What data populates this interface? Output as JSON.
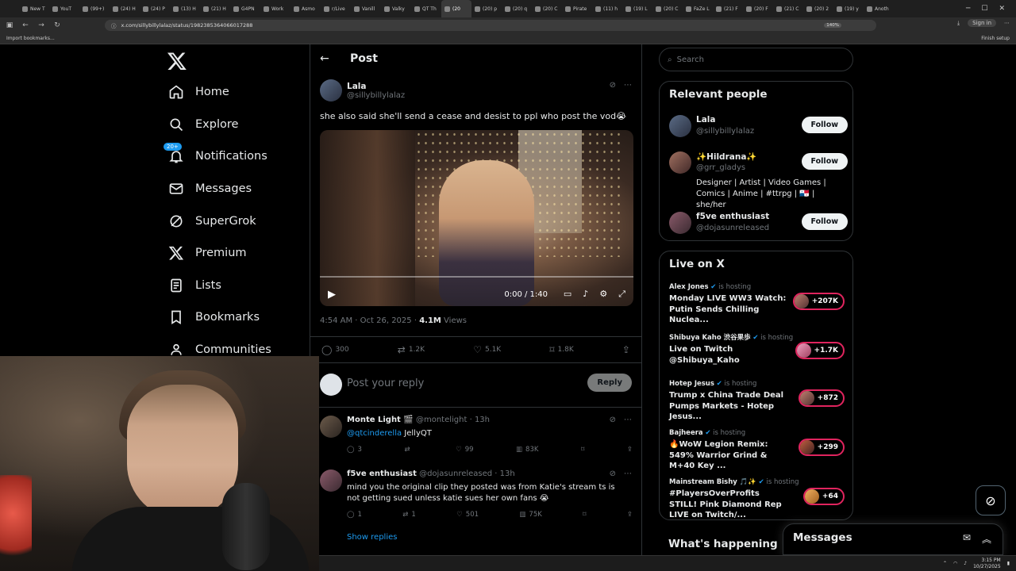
{
  "browser": {
    "tabs": [
      {
        "label": "New T"
      },
      {
        "label": "YouT"
      },
      {
        "label": "(99+)"
      },
      {
        "label": "(24) H"
      },
      {
        "label": "(24) P"
      },
      {
        "label": "(13) H"
      },
      {
        "label": "(21) H"
      },
      {
        "label": "G4PN"
      },
      {
        "label": "Work"
      },
      {
        "label": "Asmo"
      },
      {
        "label": "r/Live"
      },
      {
        "label": "Vanill"
      },
      {
        "label": "Valky"
      },
      {
        "label": "QT Th"
      },
      {
        "label": "(20"
      },
      {
        "label": "(20) p"
      },
      {
        "label": "(20) q"
      },
      {
        "label": "(20) C"
      },
      {
        "label": "Pirate"
      },
      {
        "label": "(11) h"
      },
      {
        "label": "(19) L"
      },
      {
        "label": "(20) C"
      },
      {
        "label": "FaZe L"
      },
      {
        "label": "(21) F"
      },
      {
        "label": "(20) F"
      },
      {
        "label": "(21) C"
      },
      {
        "label": "(20) 2"
      },
      {
        "label": "(19) y"
      },
      {
        "label": "Anoth"
      }
    ],
    "url": "x.com/sillybillylalaz/status/1982385364066017288",
    "zoom": "140%",
    "sign_in": "Sign in",
    "bookmarks_import": "Import bookmarks...",
    "finish_setup": "Finish setup"
  },
  "nav": {
    "items": [
      {
        "label": "Home",
        "icon": "home-icon"
      },
      {
        "label": "Explore",
        "icon": "search-icon"
      },
      {
        "label": "Notifications",
        "icon": "bell-icon"
      },
      {
        "label": "Messages",
        "icon": "mail-icon"
      },
      {
        "label": "SuperGrok",
        "icon": "grok-icon"
      },
      {
        "label": "Premium",
        "icon": "x-icon"
      },
      {
        "label": "Lists",
        "icon": "list-icon"
      },
      {
        "label": "Bookmarks",
        "icon": "bookmark-icon"
      },
      {
        "label": "Communities",
        "icon": "communities-icon"
      }
    ],
    "notif_badge": "20+"
  },
  "post": {
    "header_title": "Post",
    "author_name": "Lala",
    "author_handle": "@sillybillylalaz",
    "text": "she also said she'll send a cease and desist to ppl who post the vod😭",
    "video_time": "0:00 / 1:40",
    "video_progress": 0,
    "timestamp": "4:54 AM · Oct 26, 2025 · ",
    "views_count": "4.1M",
    "views_label": " Views",
    "stats": {
      "replies": "300",
      "reposts": "1.2K",
      "likes": "5.1K",
      "bookmarks": "1.8K"
    },
    "reply_placeholder": "Post your reply",
    "reply_button": "Reply"
  },
  "comments": [
    {
      "name": "Monte Light 🎬",
      "handle": "@montelight · 13h",
      "mention": "@qtcinderella",
      "text": " JellyQT",
      "replies": "3",
      "reposts": "",
      "likes": "99",
      "views": "83K"
    },
    {
      "name": "f5ve enthusiast",
      "handle": "@dojasunreleased · 13h",
      "mention": "",
      "text": "mind you the original clip they posted was from Katie's stream ts is not getting sued unless katie sues her own fans 😭",
      "replies": "1",
      "reposts": "1",
      "likes": "501",
      "views": "75K"
    }
  ],
  "show_replies": "Show replies",
  "search_placeholder": "Search",
  "relevant": {
    "title": "Relevant people",
    "people": [
      {
        "name": "Lala",
        "handle": "@sillybillylalaz",
        "bio": "",
        "follow": "Follow"
      },
      {
        "name": "✨Hildrana✨",
        "handle": "@grr_gladys",
        "bio": "Designer | Artist | Video Games | Comics | Anime | #ttrpg | 🇵🇦 | she/her",
        "follow": "Follow"
      },
      {
        "name": "f5ve enthusiast",
        "handle": "@dojasunreleased",
        "bio": "",
        "follow": "Follow"
      }
    ]
  },
  "live": {
    "title": "Live on X",
    "hosting_label": "is hosting",
    "items": [
      {
        "host": "Alex Jones",
        "title": "Monday LIVE WW3 Watch: Putin Sends Chilling Nuclea...",
        "count": "+207K"
      },
      {
        "host": "Shibuya Kaho 渋谷果歩",
        "title": "Live on Twitch @Shibuya_Kaho",
        "count": "+1.7K"
      },
      {
        "host": "Hotep Jesus",
        "title": "Trump x China Trade Deal Pumps Markets - Hotep Jesus...",
        "count": "+872"
      },
      {
        "host": "Bajheera",
        "title": "🔥WoW Legion Remix: 549% Warrior Grind & M+40 Key ...",
        "count": "+299"
      },
      {
        "host": "Mainstream Bishy 🎵✨",
        "title": "#PlayersOverProfits STILL! Pink Diamond Rep LIVE on Twitch/...",
        "count": "+64"
      }
    ]
  },
  "whats_happening": "What's happening",
  "messages_drawer": "Messages",
  "taskbar": {
    "time": "3:15 PM",
    "date": "10/27/2025"
  }
}
